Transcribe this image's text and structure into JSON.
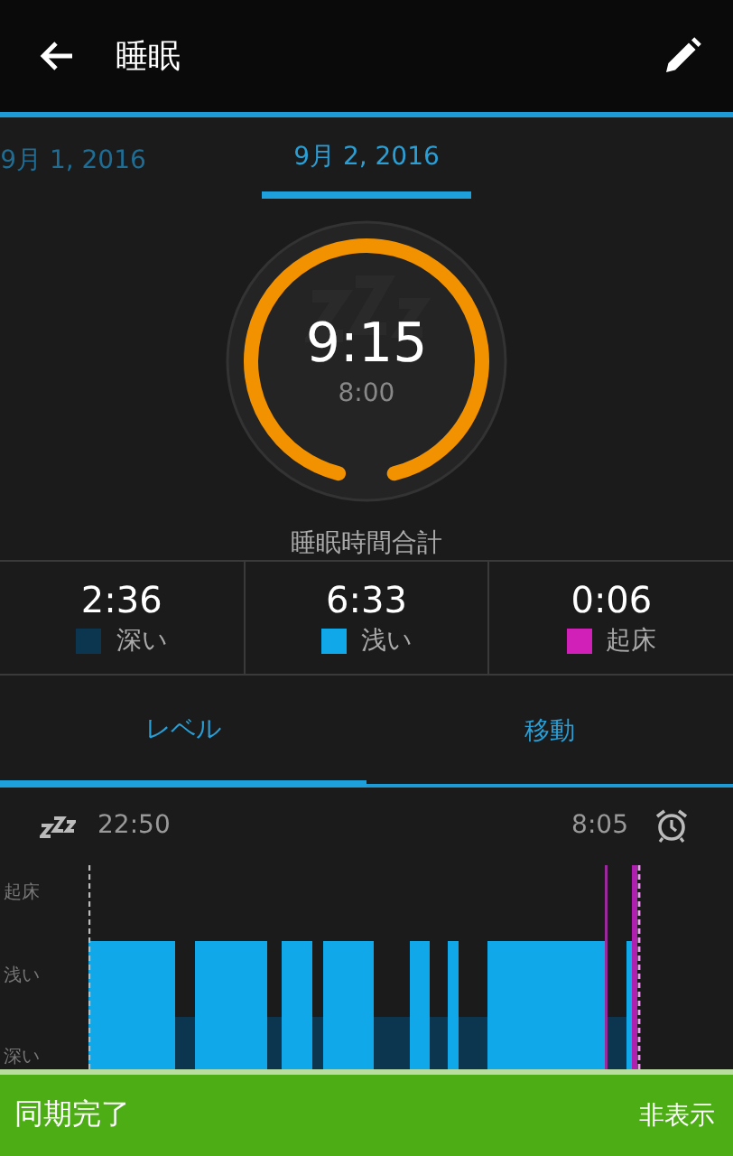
{
  "header": {
    "title": "睡眠"
  },
  "date_tabs": [
    {
      "label": "9月 1, 2016",
      "selected": false
    },
    {
      "label": "9月 2, 2016",
      "selected": true
    }
  ],
  "summary": {
    "total": "9:15",
    "goal": "8:00",
    "label": "睡眠時間合計"
  },
  "stages": [
    {
      "value": "2:36",
      "label": "深い",
      "color": "#0c3550"
    },
    {
      "value": "6:33",
      "label": "浅い",
      "color": "#10a8e8"
    },
    {
      "value": "0:06",
      "label": "起床",
      "color": "#d020b8"
    }
  ],
  "view_tabs": [
    {
      "label": "レベル",
      "selected": true
    },
    {
      "label": "移動",
      "selected": false
    }
  ],
  "timeline": {
    "start": "22:50",
    "end": "8:05",
    "levels": [
      "起床",
      "浅い",
      "深い"
    ]
  },
  "snackbar": {
    "message": "同期完了",
    "action": "非表示"
  }
}
